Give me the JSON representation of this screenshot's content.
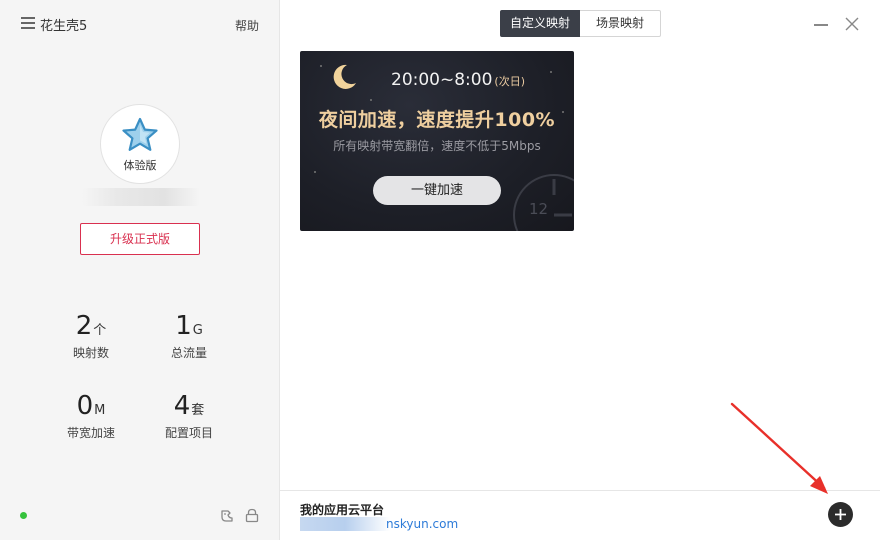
{
  "sidebar": {
    "app_title": "花生壳5",
    "help_label": "帮助",
    "plan_label": "体验版",
    "upgrade_label": "升级正式版",
    "stats": [
      {
        "value": "2",
        "unit": "个",
        "label": "映射数"
      },
      {
        "value": "1",
        "unit": "G",
        "label": "总流量"
      },
      {
        "value": "0",
        "unit": "M",
        "label": "带宽加速"
      },
      {
        "value": "4",
        "unit": "套",
        "label": "配置项目"
      }
    ],
    "status_color": "#35c23c"
  },
  "tabs": [
    {
      "label": "自定义映射",
      "active": true
    },
    {
      "label": "场景映射",
      "active": false
    }
  ],
  "banner": {
    "time": "20:00~8:00",
    "time_note": "(次日)",
    "title": "夜间加速，速度提升100%",
    "subtitle": "所有映射带宽翻倍，速度不低于5Mbps",
    "button_label": "一键加速",
    "clock_number": "12",
    "title_color": "#efcf9f"
  },
  "footer": {
    "title": "我的应用云平台",
    "link_text": "nskyun.com",
    "link_color": "#2d7bd8"
  },
  "icons": {
    "menu": "menu-icon",
    "avatar_badge": "star-icon",
    "minimize": "minimize-icon",
    "close": "close-icon",
    "bottom_left": "dino-icon",
    "bottom_right": "lock-icon",
    "add": "plus-icon"
  },
  "accent_colors": {
    "upgrade": "#d9304f",
    "active_tab": "#3b3f48",
    "annotation_arrow": "#e8302a"
  }
}
